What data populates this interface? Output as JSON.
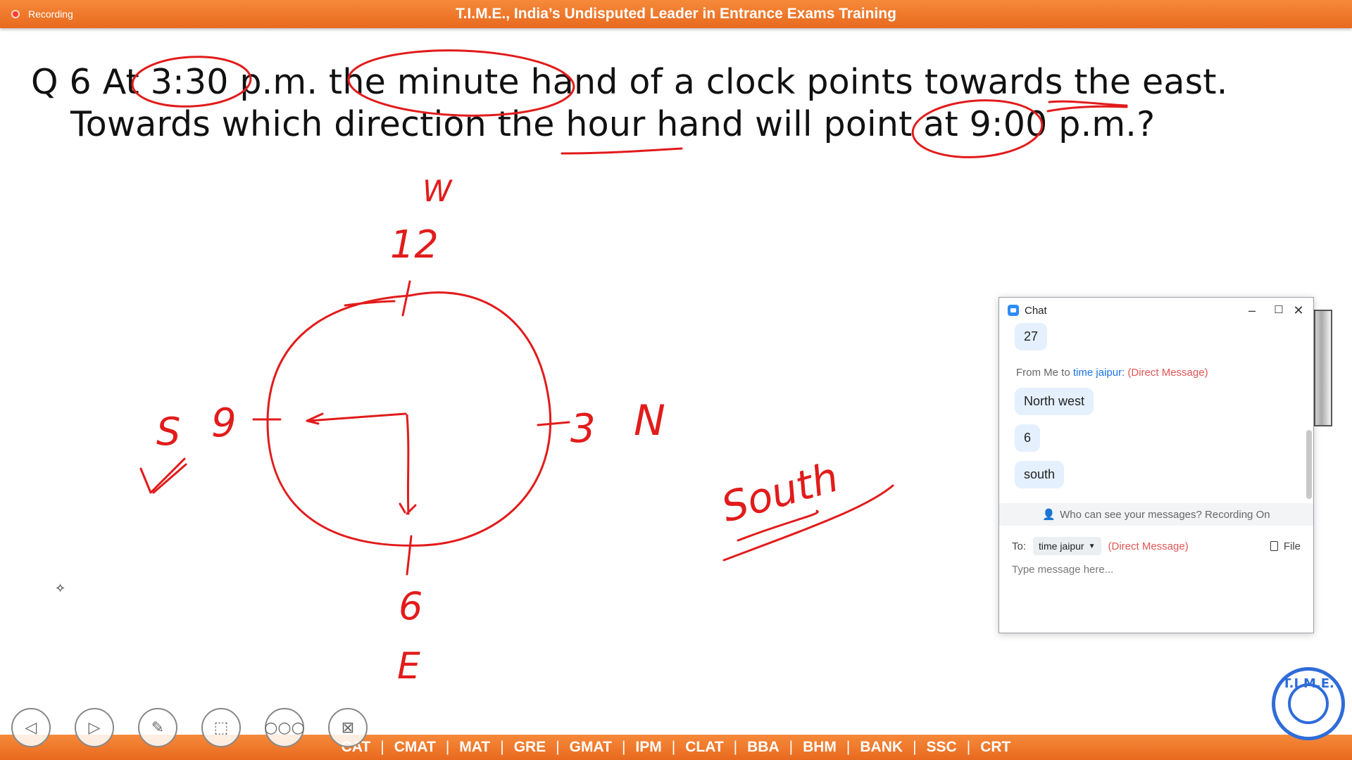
{
  "topbar": {
    "recording_label": "Recording",
    "title": "T.I.M.E., India’s Undisputed Leader in Entrance Exams Training"
  },
  "question": {
    "line1": "Q 6 At 3:30 p.m. the minute hand of a clock points towards the east.",
    "line2": "Towards which direction the hour hand will point at 9:00 p.m.?"
  },
  "handwriting": {
    "w": "W",
    "twelve": "12",
    "three": "3",
    "n": "N",
    "nine": "9",
    "s": "S",
    "six": "6",
    "e": "E",
    "answer": "South"
  },
  "chat": {
    "title": "Chat",
    "messages": [
      {
        "text": "27"
      },
      {
        "text": "North west"
      },
      {
        "text": "6"
      },
      {
        "text": "south"
      }
    ],
    "from_prefix": "From Me to",
    "from_recipient": "time jaipur:",
    "direct_message": "(Direct Message)",
    "visibility_notice": "Who can see your messages? Recording On",
    "to_label": "To:",
    "to_value": "time jaipur",
    "to_direct_message": "(Direct Message)",
    "file_label": "File",
    "input_placeholder": "Type message here..."
  },
  "bottombar": {
    "items": [
      "CAT",
      "CMAT",
      "MAT",
      "GRE",
      "GMAT",
      "IPM",
      "CLAT",
      "BBA",
      "BHM",
      "BANK",
      "SSC",
      "CRT"
    ],
    "separator": "|"
  },
  "logo": {
    "text": "T.I.M.E."
  },
  "colors": {
    "banner": "#f0782a",
    "ink": "#e21b1b",
    "chat_bubble": "#e4f0fd",
    "link_blue": "#1a73e8",
    "dm_red": "#e25555",
    "logo_blue": "#2f6cd9"
  },
  "icons": {
    "nav": [
      "chevron-left-icon",
      "chevron-right-icon",
      "pen-icon",
      "laser-pointer-icon",
      "more-icon",
      "exit-presentation-icon"
    ]
  }
}
